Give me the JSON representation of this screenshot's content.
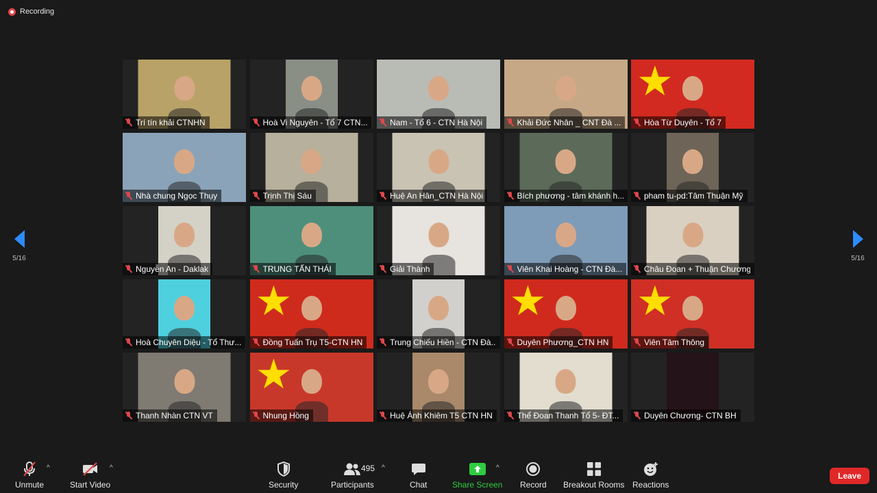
{
  "recording": {
    "label": "Recording"
  },
  "pager": {
    "left": "5/16",
    "right": "5/16"
  },
  "participants": [
    {
      "name": "Trí tín khải CTNHN",
      "bg": "#b8a268",
      "w": 135,
      "flag": false
    },
    {
      "name": "Hoà Vi Nguyên - Tổ 7 CTN...",
      "bg": "#8a8f86",
      "w": 76,
      "flag": false
    },
    {
      "name": "Nam - Tổ 6 - CTN Hà Nội",
      "bg": "#b9bbb5",
      "w": 180,
      "flag": false
    },
    {
      "name": "Khải Đức Nhân _ CNT Đà ...",
      "bg": "#c7a886",
      "w": 180,
      "flag": false
    },
    {
      "name": "Hòa Từ Duyên - Tổ 7",
      "bg": "#d22a20",
      "w": 180,
      "flag": true
    },
    {
      "name": "Nhà chung Ngọc Thụy",
      "bg": "#8aa3b8",
      "w": 180,
      "flag": false
    },
    {
      "name": "Trịnh Thị Sáu",
      "bg": "#b7b09c",
      "w": 135,
      "flag": false
    },
    {
      "name": "Huệ An Hân_CTN Hà Nội",
      "bg": "#c9c3b4",
      "w": 135,
      "flag": false
    },
    {
      "name": "Bích phương - tâm khánh h...",
      "bg": "#5c6a5a",
      "w": 135,
      "flag": false
    },
    {
      "name": "pham tu-pd:Tâm Thuận Mỹ",
      "bg": "#6e6457",
      "w": 76,
      "flag": false
    },
    {
      "name": "Nguyễn An - Daklak",
      "bg": "#d4d1c7",
      "w": 76,
      "flag": false
    },
    {
      "name": "TRUNG TẤN THÁI",
      "bg": "#4e8f7c",
      "w": 180,
      "flag": false
    },
    {
      "name": "Giải Thành",
      "bg": "#e7e3df",
      "w": 135,
      "flag": false
    },
    {
      "name": "Viên Khai Hoàng - CTN Đà...",
      "bg": "#7e9bb8",
      "w": 180,
      "flag": false
    },
    {
      "name": "Châu Đoan + Thuận Chương...",
      "bg": "#d9d0c2",
      "w": 135,
      "flag": false
    },
    {
      "name": "Hoà Chuyên Diệu - Tổ Thư...",
      "bg": "#4fd0df",
      "w": 76,
      "flag": false
    },
    {
      "name": "Đồng Tuấn Trụ T5-CTN HN",
      "bg": "#cf2b1d",
      "w": 180,
      "flag": true
    },
    {
      "name": "Trung Chiếu Hiền - CTN Đà...",
      "bg": "#d2d0cc",
      "w": 76,
      "flag": false
    },
    {
      "name": "Duyên Phương_CTN HN",
      "bg": "#d02a1e",
      "w": 180,
      "flag": true
    },
    {
      "name": "Viên Tâm Thông",
      "bg": "#cf2f25",
      "w": 180,
      "flag": true
    },
    {
      "name": "Thanh Nhàn CTN VT",
      "bg": "#7f7a72",
      "w": 135,
      "flag": false
    },
    {
      "name": "Nhung Hồng",
      "bg": "#c8382a",
      "w": 180,
      "flag": true
    },
    {
      "name": "Huệ Ánh Khiêm T5 CTN HN",
      "bg": "#a9896a",
      "w": 76,
      "flag": false
    },
    {
      "name": "Thể Đoan Thanh  Tổ 5- ĐT...",
      "bg": "#e3ddd0",
      "w": 135,
      "flag": false
    },
    {
      "name": "Duyên Chương- CTN BH",
      "bg": "#241318",
      "w": 76,
      "flag": false
    }
  ],
  "toolbar": {
    "unmute": "Unmute",
    "start_video": "Start Video",
    "security": "Security",
    "participants": "Participants",
    "participants_count": "495",
    "chat": "Chat",
    "share_screen": "Share Screen",
    "record": "Record",
    "breakout_rooms": "Breakout Rooms",
    "reactions": "Reactions",
    "leave": "Leave"
  },
  "colors": {
    "accent": "#2d8cff",
    "share_green": "#2ecc40",
    "leave_red": "#e02828",
    "muted_red": "#e0474c"
  }
}
